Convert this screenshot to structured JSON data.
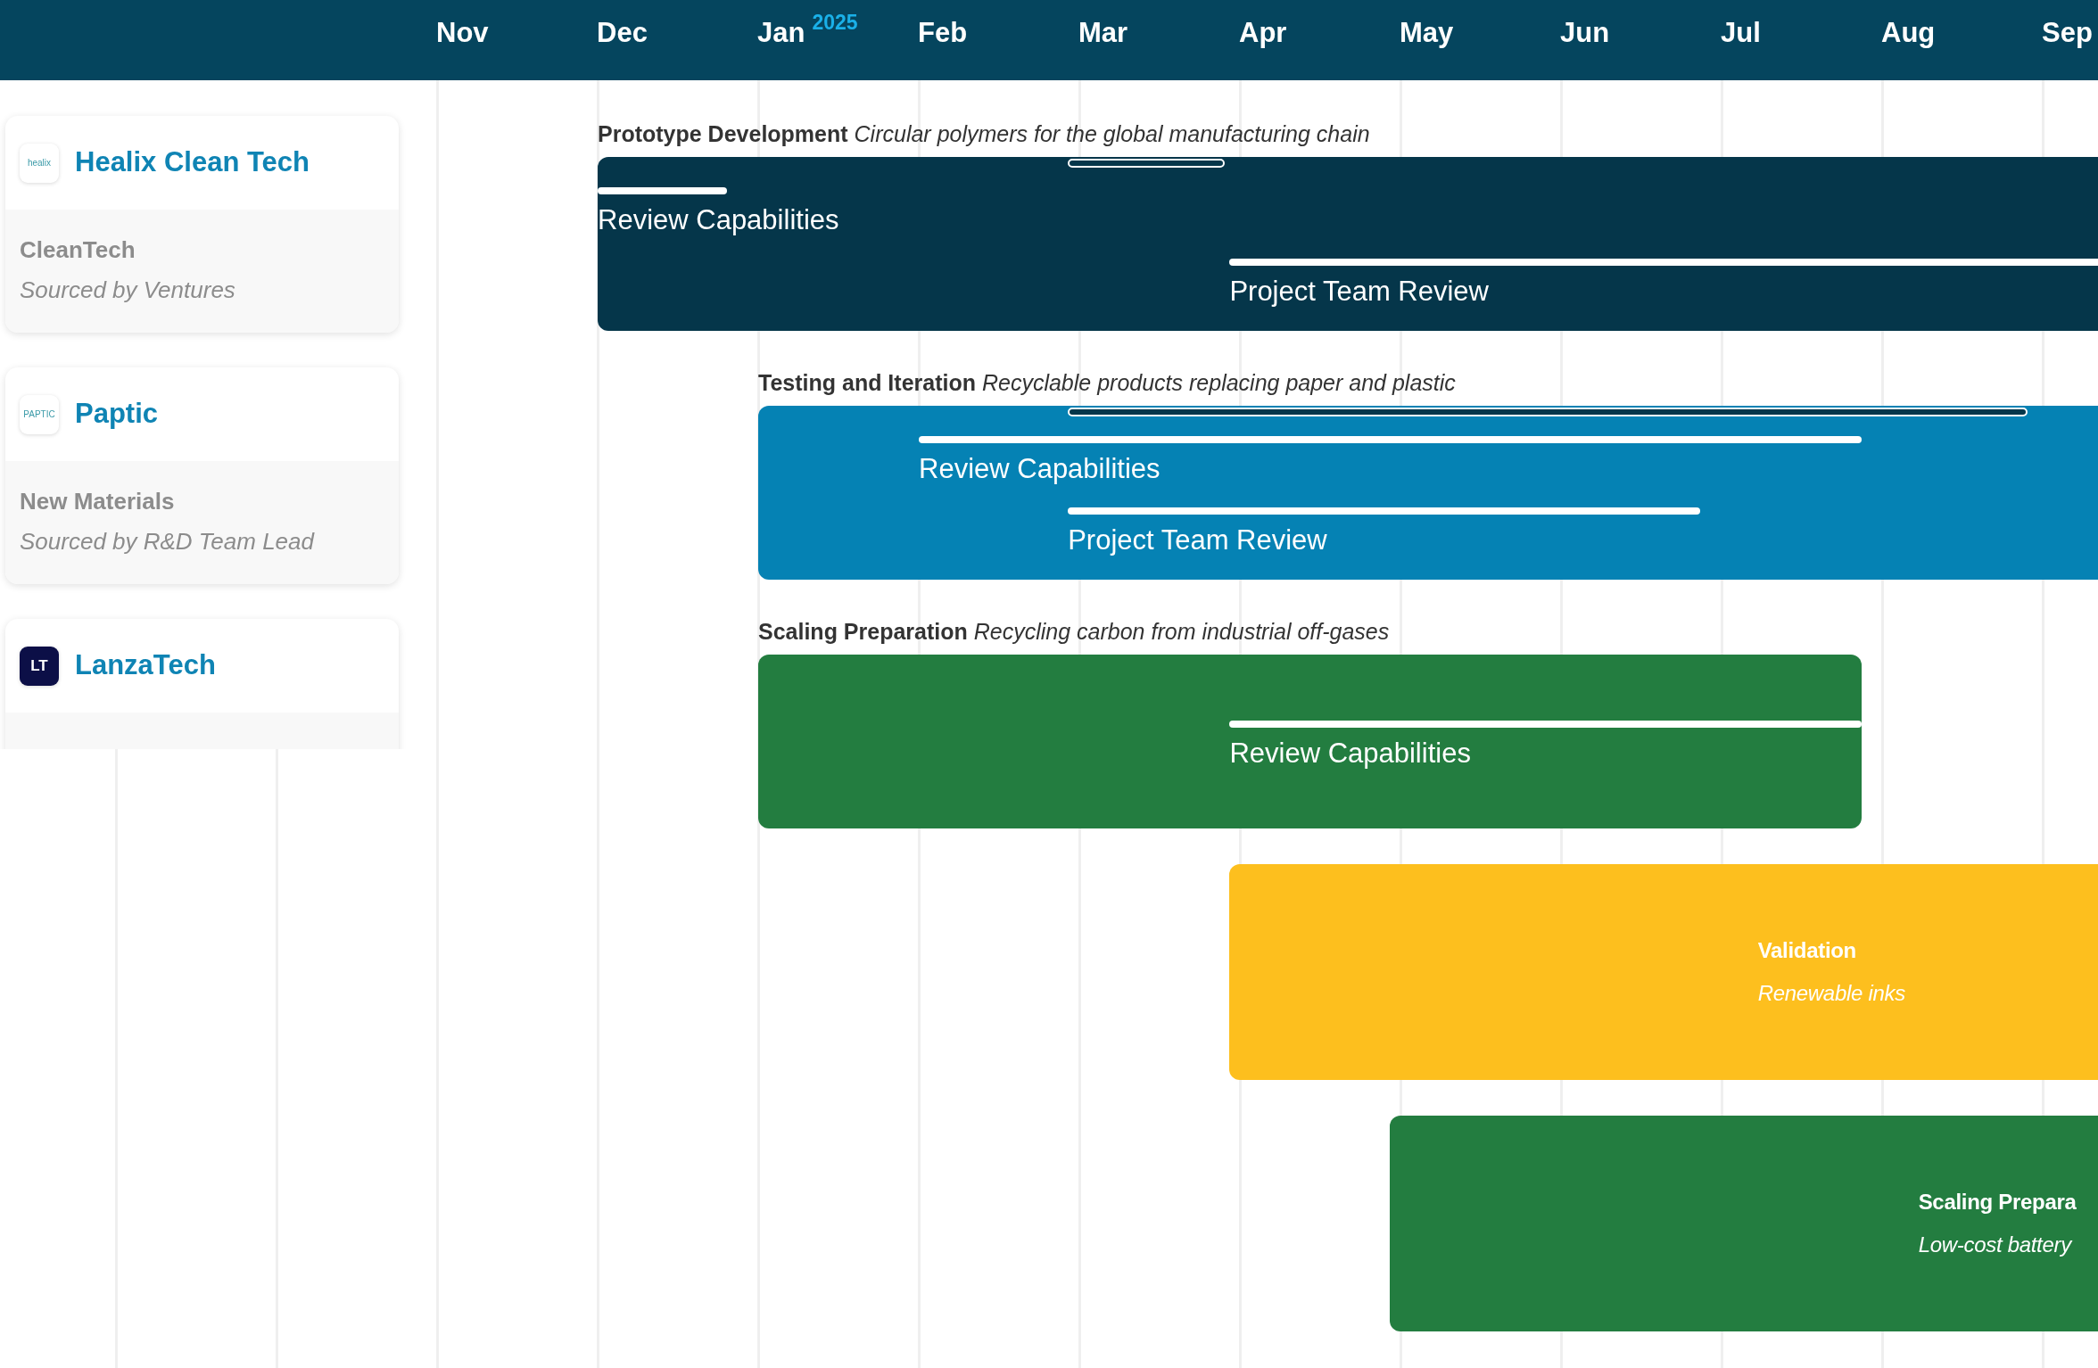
{
  "header": {
    "months": [
      {
        "label": "Nov"
      },
      {
        "label": "Dec"
      },
      {
        "label": "Jan",
        "year": "2025"
      },
      {
        "label": "Feb"
      },
      {
        "label": "Mar"
      },
      {
        "label": "Apr"
      },
      {
        "label": "May"
      },
      {
        "label": "Jun"
      },
      {
        "label": "Jul"
      },
      {
        "label": "Aug"
      },
      {
        "label": "Sep"
      }
    ]
  },
  "companies": [
    {
      "name": "Healix Clean Tech",
      "logo": {
        "kind": "wordmark",
        "text": "healix"
      },
      "sector": "CleanTech",
      "sourced_by": "Sourced by Ventures"
    },
    {
      "name": "Paptic",
      "logo": {
        "kind": "wordmark",
        "text": "PAPTIC"
      },
      "sector": "New Materials",
      "sourced_by": "Sourced by R&D Team Lead"
    },
    {
      "name": "LanzaTech",
      "logo": {
        "kind": "monogram",
        "text": "LT"
      }
    }
  ],
  "phases": [
    {
      "kind": "captioned",
      "title": "Prototype Development",
      "subtitle": "Circular polymers for the global manufacturing chain",
      "color": "#05364a",
      "tracks": [
        {
          "kind": "span"
        },
        {
          "kind": "line",
          "label": "Review Capabilities"
        },
        {
          "kind": "line",
          "label": "Project Team Review"
        }
      ]
    },
    {
      "kind": "captioned",
      "title": "Testing and Iteration",
      "subtitle": "Recyclable products replacing paper and plastic",
      "color": "#0582b4",
      "tracks": [
        {
          "kind": "span"
        },
        {
          "kind": "line",
          "label": "Review Capabilities"
        },
        {
          "kind": "line",
          "label": "Project Team Review"
        }
      ]
    },
    {
      "kind": "captioned",
      "title": "Scaling Preparation",
      "subtitle": "Recycling carbon from industrial off-gases",
      "color": "#237d40",
      "tracks": [
        {
          "kind": "line",
          "label": "Review Capabilities"
        }
      ]
    },
    {
      "kind": "inline",
      "title": "Validation",
      "subtitle": "Renewable inks",
      "color": "#fdbf1e"
    },
    {
      "kind": "inline",
      "title": "Scaling Prepara",
      "subtitle": "Low-cost battery",
      "color": "#237d40"
    }
  ]
}
